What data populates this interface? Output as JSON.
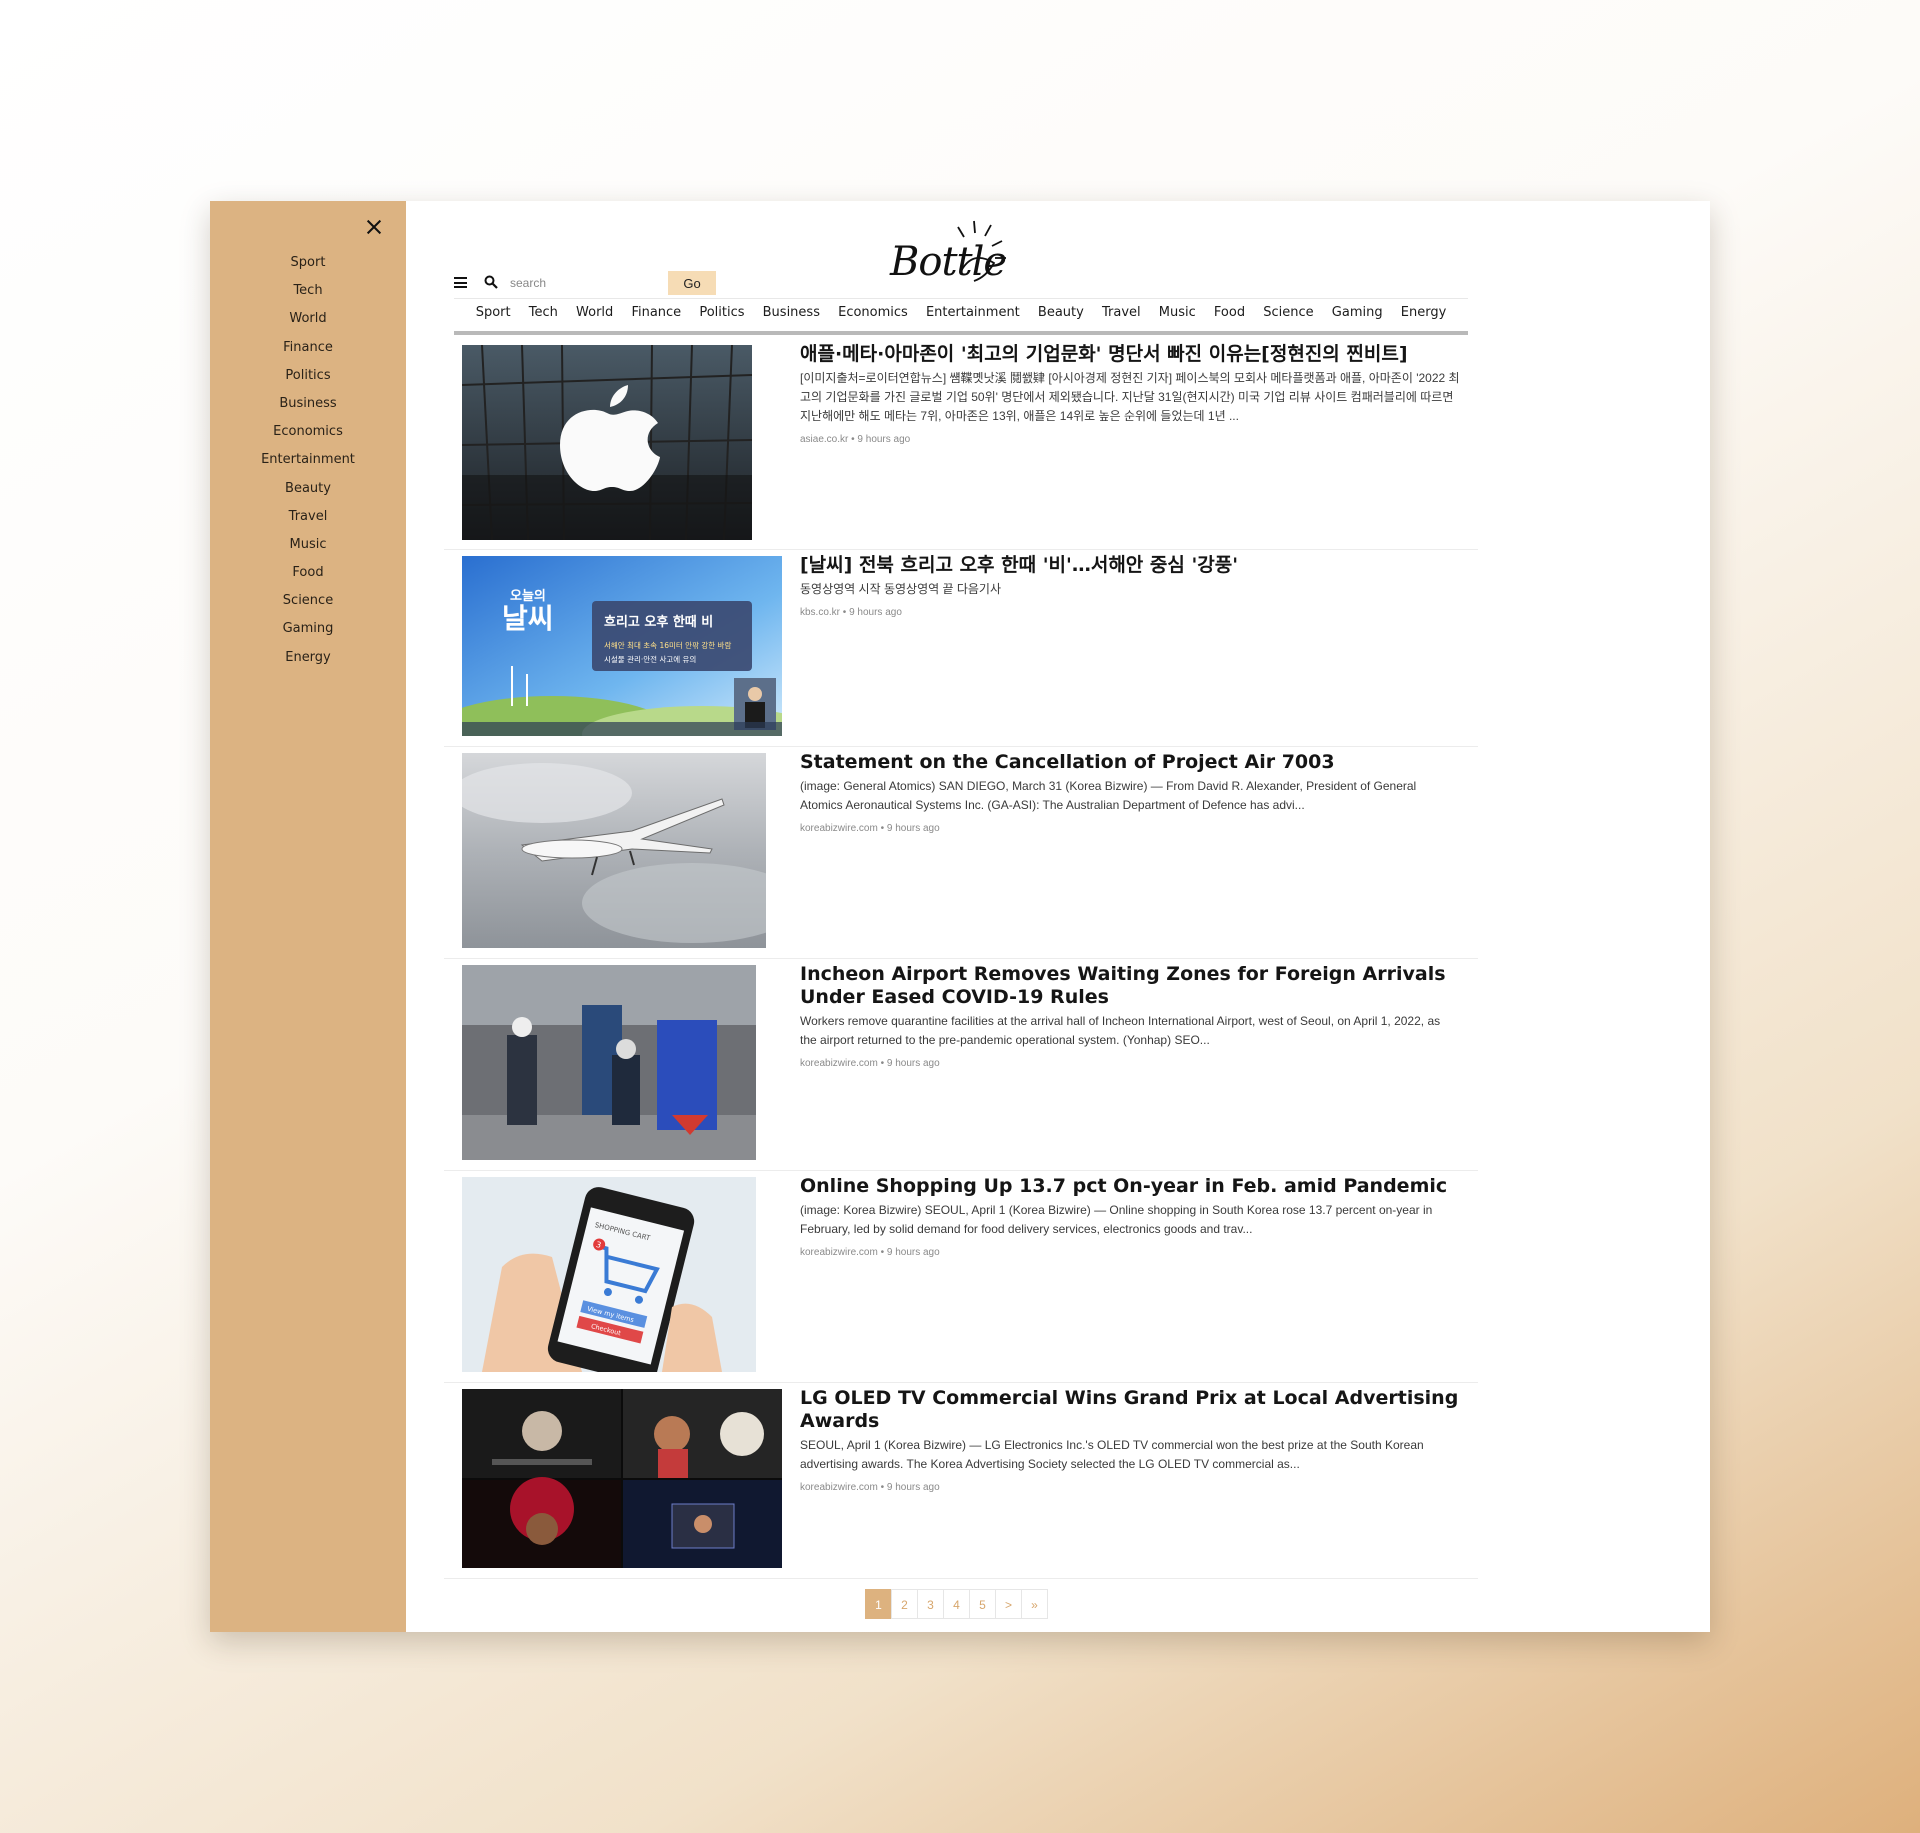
{
  "sidebar": {
    "close_label": "×",
    "items": [
      "Sport",
      "Tech",
      "World",
      "Finance",
      "Politics",
      "Business",
      "Economics",
      "Entertainment",
      "Beauty",
      "Travel",
      "Music",
      "Food",
      "Science",
      "Gaming",
      "Energy"
    ]
  },
  "header": {
    "logo_text": "Bottle",
    "search_placeholder": "search",
    "go_label": "Go"
  },
  "nav": {
    "categories": [
      "Sport",
      "Tech",
      "World",
      "Finance",
      "Politics",
      "Business",
      "Economics",
      "Entertainment",
      "Beauty",
      "Travel",
      "Music",
      "Food",
      "Science",
      "Gaming",
      "Energy"
    ]
  },
  "articles": [
    {
      "title": "애플·메타·아마존이 '최고의 기업문화' 명단서 빠진 이유는[정현진의 찐비트]",
      "description": "[이미지출처=로이터연합뉴스] 썜鞢몟낫溪 鬩쐜肄 [아시아경제 정현진 기자] 페이스북의 모회사 메타플랫폼과 애플, 아마존이 '2022 최고의 기업문화를 가진 글로벌 기업 50위' 명단에서 제외됐습니다. 지난달 31일(현지시간) 미국 기업 리뷰 사이트 컴패러블리에 따르면 지난해에만 해도 메타는 7위, 아마존은 13위, 애플은 14위로 높은 순위에 들었는데 1년 ...",
      "meta": "asiae.co.kr • 9 hours ago",
      "image": "apple-logo-building"
    },
    {
      "title": "[날씨] 전북 흐리고 오후 한때 '비'…서해안 중심 '강풍'",
      "description": "동영상영역 시작 동영상영역 끝 다음기사",
      "meta": "kbs.co.kr • 9 hours ago",
      "image": "weather-broadcast",
      "image_text": {
        "brand_top": "오늘의",
        "brand_main": "날씨",
        "headline": "흐리고 오후 한때 비",
        "line1": "서해안 최대 초속 16미터 안팎 강한 바람",
        "line2": "시설물 관리·안전 사고에 유의"
      }
    },
    {
      "title": "Statement on the Cancellation of Project Air 7003",
      "description": "(image: General Atomics) SAN DIEGO, March 31 (Korea Bizwire) — From David R. Alexander, President of General Atomics Aeronautical Systems Inc. (GA-ASI):  The Australian Department of Defence has advi...",
      "meta": "koreabizwire.com • 9 hours ago",
      "image": "drone-in-clouds"
    },
    {
      "title": "Incheon Airport Removes Waiting Zones for Foreign Arrivals Under Eased COVID-19 Rules",
      "description": "Workers remove quarantine facilities at the arrival hall of Incheon International Airport, west of Seoul, on April 1, 2022, as the airport returned to the pre-pandemic operational system. (Yonhap) SEO...",
      "meta": "koreabizwire.com • 9 hours ago",
      "image": "airport-workers"
    },
    {
      "title": "Online Shopping Up 13.7 pct On-year in Feb. amid Pandemic",
      "description": "(image: Korea Bizwire) SEOUL, April 1 (Korea Bizwire) — Online shopping in South Korea rose 13.7 percent on-year in February, led by solid demand for food delivery services, electronics goods and trav...",
      "meta": "koreabizwire.com • 9 hours ago",
      "image": "phone-shopping-cart",
      "image_text": {
        "cart": "SHOPPING CART",
        "badge": "3",
        "view": "View my items",
        "checkout": "Checkout"
      }
    },
    {
      "title": "LG OLED TV Commercial Wins Grand Prix at Local Advertising Awards",
      "description": "SEOUL, April 1 (Korea Bizwire) — LG Electronics Inc.'s OLED TV commercial won the best prize at the South Korean advertising awards. The Korea Advertising Society selected the LG OLED TV commercial as...",
      "meta": "koreabizwire.com • 9 hours ago",
      "image": "lg-oled-collage"
    }
  ],
  "pagination": {
    "pages": [
      "1",
      "2",
      "3",
      "4",
      "5"
    ],
    "next": ">",
    "last": "»",
    "current": "1"
  },
  "colors": {
    "sidebar": "#dcb382",
    "accent": "#ddb27f",
    "go_button": "#f6dcb5"
  }
}
